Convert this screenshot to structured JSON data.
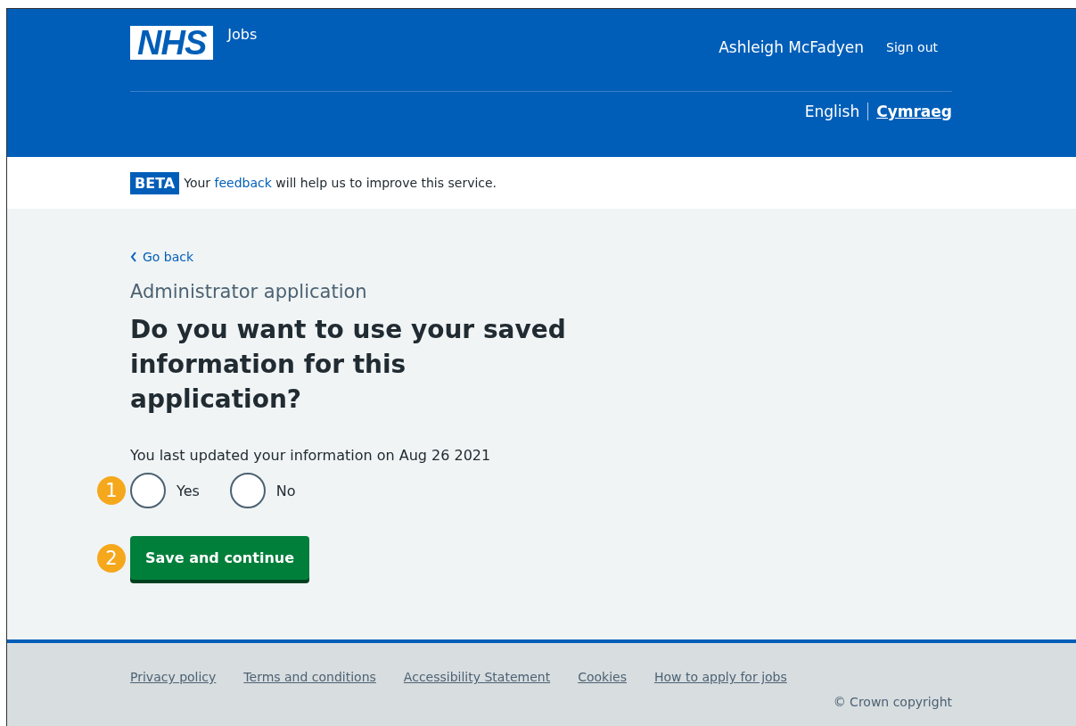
{
  "header": {
    "logo": "NHS",
    "service": "Jobs",
    "user": "Ashleigh McFadyen",
    "sign_out": "Sign out",
    "languages": [
      {
        "label": "English",
        "selected": true
      },
      {
        "label": "Cymraeg",
        "selected": false
      }
    ]
  },
  "banner": {
    "tag": "BETA",
    "text_before": "Your",
    "link": "feedback",
    "text_after": "will help us to improve this service."
  },
  "back_link": "Go back",
  "caption": "Administrator application",
  "heading": "Do you want to use your saved information for this application?",
  "hint": "You last updated your information on Aug 26 2021",
  "radios_marker": "1",
  "radios": [
    {
      "label": "Yes",
      "selected": false
    },
    {
      "label": "No",
      "selected": false
    }
  ],
  "button_marker": "2",
  "button": "Save and continue",
  "footer": {
    "links": [
      "Privacy policy",
      "Terms and conditions",
      "Accessibility Statement",
      "Cookies",
      "How to apply for jobs"
    ],
    "copyright": "© Crown copyright"
  }
}
